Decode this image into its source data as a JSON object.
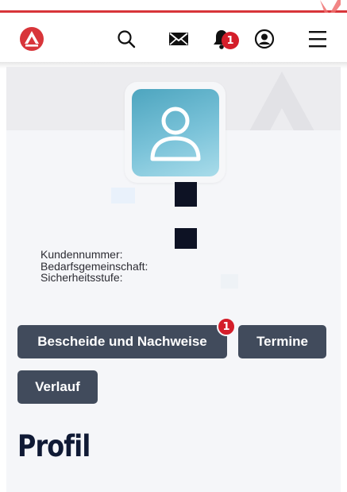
{
  "header": {
    "logo_icon": "arbeitsagentur-logo-icon",
    "search_icon": "search-icon",
    "mail_icon": "mail-icon",
    "bell_icon": "bell-icon",
    "notification_count": "1",
    "account_icon": "user-circle-icon",
    "menu_icon": "hamburger-menu-icon"
  },
  "profile": {
    "avatar_icon": "user-avatar-icon",
    "fields": {
      "kundennummer_label": "Kundennummer:",
      "bedarfsgemeinschaft_label": "Bedarfsgemeinschaft:",
      "sicherheitsstufe_label": "Sicherheitsstufe:"
    }
  },
  "actions": {
    "bescheide_label": "Bescheide und Nachweise",
    "bescheide_badge": "1",
    "termine_label": "Termine",
    "verlauf_label": "Verlauf"
  },
  "page": {
    "title": "Profil"
  },
  "colors": {
    "brand_red": "#d8353a",
    "button_bg": "#414b5c",
    "badge_red": "#d41e2a",
    "title_color": "#101a35"
  }
}
